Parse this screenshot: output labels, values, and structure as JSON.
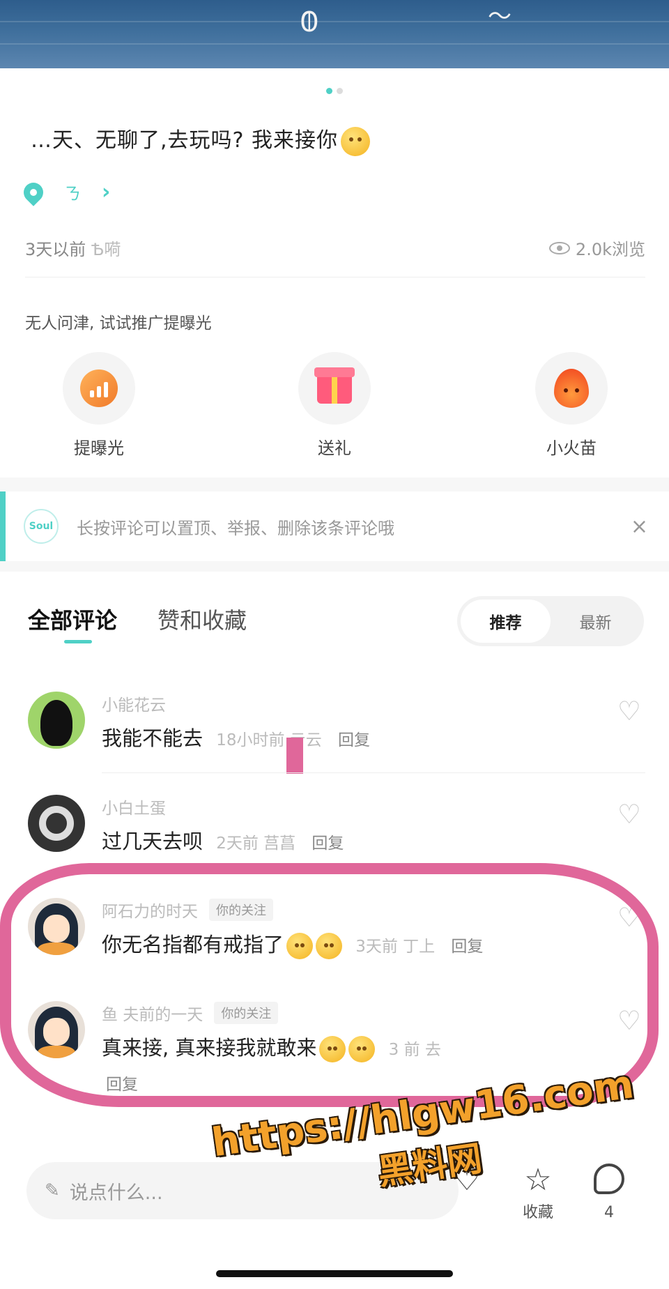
{
  "post": {
    "text": "…天、无聊了,去玩吗? 我来接你",
    "location_label": "ㄋ",
    "time": "3天以前",
    "time_extra": "Ѣ嗬",
    "views": "2.0k浏览"
  },
  "promo": {
    "tip": "无人问津, 试试推广提曝光",
    "actions": [
      {
        "label": "提曝光",
        "icon": "expose-icon"
      },
      {
        "label": "送礼",
        "icon": "gift-icon"
      },
      {
        "label": "小火苗",
        "icon": "fire-icon"
      }
    ]
  },
  "notice": {
    "bulb_text": "Soul",
    "text": "长按评论可以置顶、举报、删除该条评论哦",
    "close": "×"
  },
  "tabs": {
    "all_comments": "全部评论",
    "likes_favs": "赞和收藏"
  },
  "sort": {
    "recommend": "推荐",
    "latest": "最新"
  },
  "comments": [
    {
      "name": "小能花云",
      "text": "我能不能去",
      "time": "18小时前 亓云",
      "reply": "回复",
      "tag": ""
    },
    {
      "name": "小白土蛋",
      "text": "过几天去呗",
      "time": "2天前 莒菖",
      "reply": "回复",
      "tag": ""
    },
    {
      "name": "阿石力的时天",
      "text": "你无名指都有戒指了",
      "time": "3天前 丁上",
      "reply": "回复",
      "tag": "你的关注"
    },
    {
      "name": "鱼 夫前的一天",
      "text": "真来接, 真来接我就敢来",
      "time": "3 前 去",
      "reply": "回复",
      "tag": "你的关注"
    }
  ],
  "bottom_bar": {
    "input_placeholder": "说点什么...",
    "favorite_label": "收藏",
    "comment_count": "4"
  },
  "watermark": {
    "url": "https://hlgw16.com",
    "cn": "黑料网"
  },
  "colors": {
    "accent": "#4fd0c6",
    "highlight": "#e0679a",
    "watermark": "#f3a12b"
  }
}
